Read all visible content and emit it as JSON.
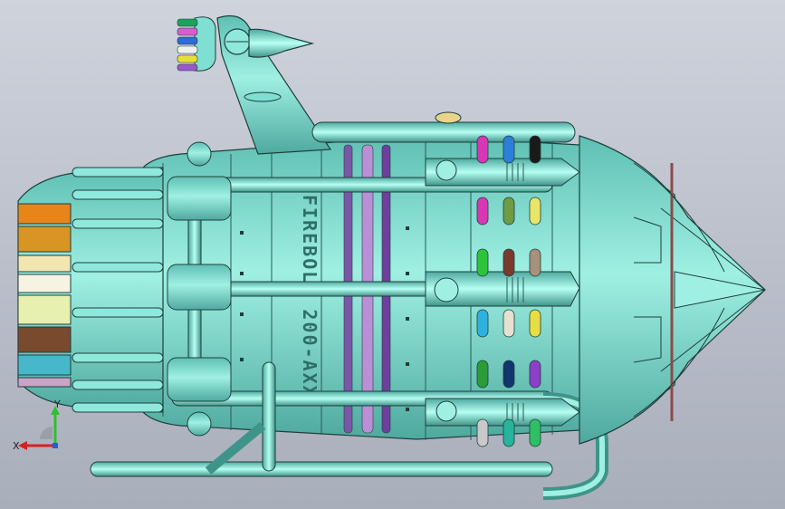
{
  "viewport": {
    "name": "cad-3d-viewport",
    "background": "#b9bec9"
  },
  "model": {
    "engraving": "FIREBOLT 200-AXX",
    "body_color": "#7fdfd2",
    "edge_color": "#1f3f3c",
    "fin_colors": [
      "#e7841a",
      "#d89523",
      "#f2e6b0",
      "#f7f3e3",
      "#e8f0b0",
      "#7a4a2f",
      "#46b8c9",
      "#c9a3c8"
    ],
    "nozzle_colors": [
      "#1aa35c",
      "#d95bcf",
      "#2f6bd8",
      "#f0f0f0",
      "#e9dd3a",
      "#9a58c9"
    ],
    "ring_colors": [
      "#7b56a8",
      "#b98fd6",
      "#6e3f9c"
    ],
    "capsule_colors": [
      "#d837b4",
      "#2c7fd8",
      "#1a1a1a",
      "#d837b4",
      "#6f9b45",
      "#e9e46a",
      "#2dc43a",
      "#7a3b2e",
      "#a8917a",
      "#2fb1e0",
      "#e5e0d0",
      "#e8dd43",
      "#2b9c38",
      "#11356e",
      "#8d3fc9",
      "#c9c9c9",
      "#27b39c",
      "#2ec062"
    ]
  },
  "triad": {
    "x_label": "X",
    "y_label": "Y",
    "x_color": "#d62020",
    "y_color": "#2ec02e",
    "z_color": "#2060e0"
  }
}
